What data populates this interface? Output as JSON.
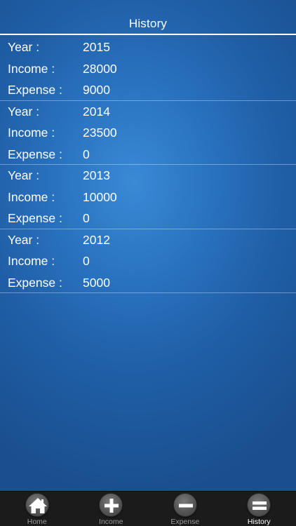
{
  "header": {
    "title": "History"
  },
  "labels": {
    "year": "Year :",
    "income": "Income :",
    "expense": "Expense :"
  },
  "records": [
    {
      "year": "2015",
      "income": "28000",
      "expense": "9000"
    },
    {
      "year": "2014",
      "income": "23500",
      "expense": "0"
    },
    {
      "year": "2013",
      "income": "10000",
      "expense": "0"
    },
    {
      "year": "2012",
      "income": "0",
      "expense": "5000"
    }
  ],
  "tabbar": {
    "active": "History",
    "tabs": [
      {
        "label": "Home",
        "icon": "home-icon"
      },
      {
        "label": "Income",
        "icon": "plus-icon"
      },
      {
        "label": "Expense",
        "icon": "minus-icon"
      },
      {
        "label": "History",
        "icon": "equals-icon"
      }
    ]
  },
  "colors": {
    "background_center": "#3a8ad6",
    "background_edge": "#1a4e8c",
    "tabbar": "#1b1b1b",
    "tab_inactive_text": "#9a9a9a",
    "tab_active_text": "#ffffff"
  }
}
